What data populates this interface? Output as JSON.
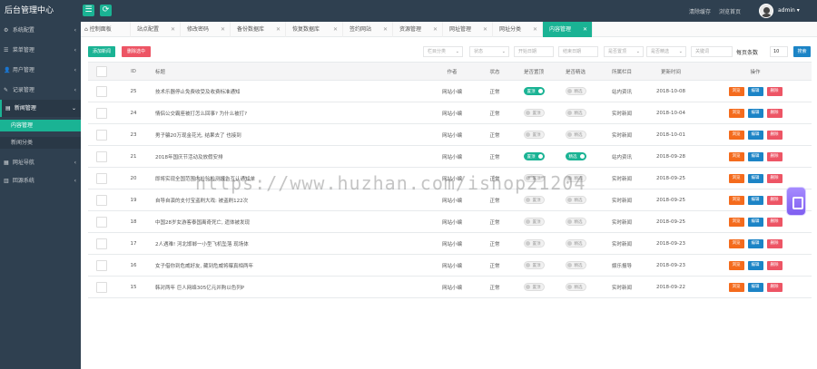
{
  "header": {
    "brand": "后台管理中心",
    "menu_icon": "☰",
    "refresh_icon": "⟳",
    "clear_cache": "清除缓存",
    "view_home": "浏览首页",
    "username": "admin ▾"
  },
  "sidebar": {
    "items": [
      {
        "icon": "⚙",
        "label": "系统配置",
        "arrow": "‹"
      },
      {
        "icon": "☰",
        "label": "菜单管理",
        "arrow": "‹"
      },
      {
        "icon": "👤",
        "label": "用户管理",
        "arrow": "‹"
      },
      {
        "icon": "✎",
        "label": "记录管理",
        "arrow": "‹"
      },
      {
        "icon": "▤",
        "label": "新闻管理",
        "arrow": "⌄"
      },
      {
        "icon": "▦",
        "label": "网址导航",
        "arrow": "‹"
      },
      {
        "icon": "▥",
        "label": "回源系统",
        "arrow": "‹"
      }
    ],
    "sub_items": [
      "内容管理",
      "新闻分类"
    ]
  },
  "tabs": [
    {
      "label": "控制面板"
    },
    {
      "label": "站点配置"
    },
    {
      "label": "修改密码"
    },
    {
      "label": "备份数据库"
    },
    {
      "label": "恢复数据库"
    },
    {
      "label": "签约网站"
    },
    {
      "label": "资源管理"
    },
    {
      "label": "网址管理"
    },
    {
      "label": "网址分类"
    },
    {
      "label": "内容管理"
    }
  ],
  "toolbar": {
    "add_label": "添加新闻",
    "delete_label": "删除选中",
    "filters": [
      "栏目分类",
      "状态",
      "开始日期",
      "结束日期",
      "是否置顶",
      "是否精选",
      "关键词"
    ],
    "per_page_label": "每页条数",
    "per_page_value": "10",
    "search_label": "搜索"
  },
  "table": {
    "headers": [
      "",
      "ID",
      "标题",
      "作者",
      "状态",
      "是否置顶",
      "是否精选",
      "所属栏目",
      "更新时间",
      "操作"
    ],
    "toggle_top_on": "置顶",
    "toggle_top_off": "置顶",
    "toggle_pick_on": "精选",
    "toggle_pick_off": "精选",
    "actions": [
      "浏览",
      "编辑",
      "删除"
    ],
    "rows": [
      {
        "id": "25",
        "title": "技术乐器停止免费收受及收费标准通知",
        "author": "网站小编",
        "status": "正常",
        "top": true,
        "pick": false,
        "category": "站内资讯",
        "date": "2018-10-08"
      },
      {
        "id": "24",
        "title": "情侣公交霸座被打怎么回事? 为什么被打?",
        "author": "网站小编",
        "status": "正常",
        "top": false,
        "pick": false,
        "category": "实时新闻",
        "date": "2018-10-04"
      },
      {
        "id": "23",
        "title": "男子骗20万现金花光, 结果去了 也接到",
        "author": "网站小编",
        "status": "正常",
        "top": false,
        "pick": false,
        "category": "实时新闻",
        "date": "2018-10-01"
      },
      {
        "id": "21",
        "title": "2018年国庆节活动及放假安排",
        "author": "网站小编",
        "status": "正常",
        "top": true,
        "pick": true,
        "category": "站内资讯",
        "date": "2018-09-28"
      },
      {
        "id": "20",
        "title": "即将实现全国范围内检验检测报告互认通知单",
        "author": "网站小编",
        "status": "正常",
        "top": false,
        "pick": false,
        "category": "实时新闻",
        "date": "2018-09-25"
      },
      {
        "id": "19",
        "title": "自导自演的支付宝盗刷大戏: 被盗刷122次",
        "author": "网站小编",
        "status": "正常",
        "top": false,
        "pick": false,
        "category": "实时新闻",
        "date": "2018-09-25"
      },
      {
        "id": "18",
        "title": "中国28岁女游客泰国离奇死亡, 遗体被发现",
        "author": "网站小编",
        "status": "正常",
        "top": false,
        "pick": false,
        "category": "实时新闻",
        "date": "2018-09-25"
      },
      {
        "id": "17",
        "title": "2人遇难! 河北邯郸一小型飞机坠落 现场体",
        "author": "网站小编",
        "status": "正常",
        "top": false,
        "pick": false,
        "category": "实时新闻",
        "date": "2018-09-23"
      },
      {
        "id": "16",
        "title": "女子借你到危威好友, 藏到危威将曝真相两年",
        "author": "网站小编",
        "status": "正常",
        "top": false,
        "pick": false,
        "category": "娱乐报导",
        "date": "2018-09-23"
      },
      {
        "id": "15",
        "title": "韩对两年 巨人网络305亿元并购以色列P",
        "author": "网站小编",
        "status": "正常",
        "top": false,
        "pick": false,
        "category": "实时新闻",
        "date": "2018-09-22"
      }
    ]
  },
  "watermark": "https://www.huzhan.com/ishop21204"
}
